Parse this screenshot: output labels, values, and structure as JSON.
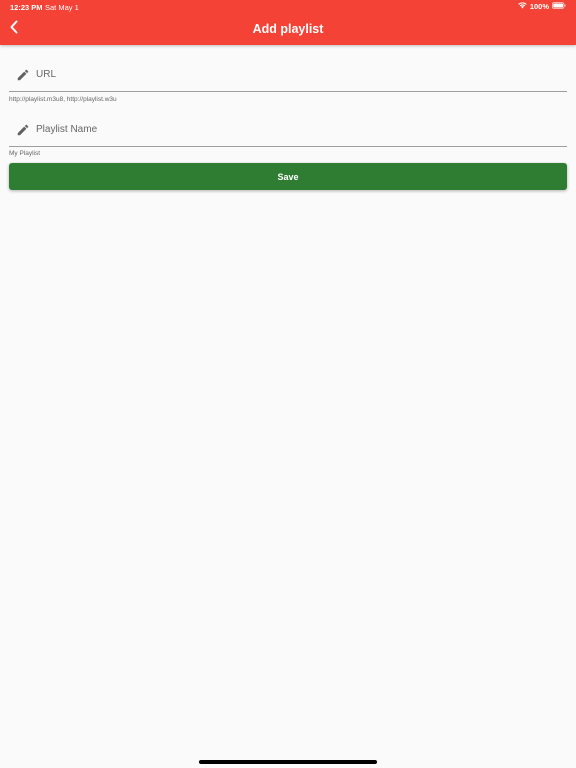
{
  "status_bar": {
    "time": "12:23 PM",
    "date": "Sat May 1",
    "battery": "100%",
    "icons": [
      "wifi-icon",
      "battery-icon"
    ]
  },
  "header": {
    "title": "Add playlist",
    "back_icon": "chevron-left-icon",
    "background_color": "#f44336"
  },
  "form": {
    "url": {
      "placeholder": "URL",
      "value": "",
      "helper": "http://playlist.m3u8, http://playlist.w3u",
      "icon": "pencil-icon"
    },
    "name": {
      "placeholder": "Playlist Name",
      "value": "",
      "helper": "My Playlist",
      "icon": "pencil-icon"
    },
    "save_label": "Save",
    "save_color": "#2e7d32"
  }
}
